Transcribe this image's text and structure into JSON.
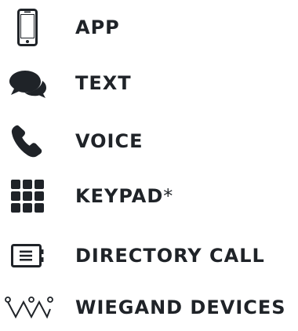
{
  "menu": {
    "items": [
      {
        "label": "APP",
        "icon": "smartphone-icon"
      },
      {
        "label": "TEXT",
        "icon": "chat-bubbles-icon"
      },
      {
        "label": "VOICE",
        "icon": "phone-handset-icon"
      },
      {
        "label": "KEYPAD",
        "suffix": "*",
        "icon": "keypad-grid-icon"
      },
      {
        "label": "DIRECTORY CALL",
        "icon": "directory-icon"
      },
      {
        "label": "WIEGAND DEVICES",
        "icon": "wiegand-devices-icon"
      }
    ]
  },
  "colors": {
    "text": "#1f2328",
    "icon": "#1f2328"
  }
}
